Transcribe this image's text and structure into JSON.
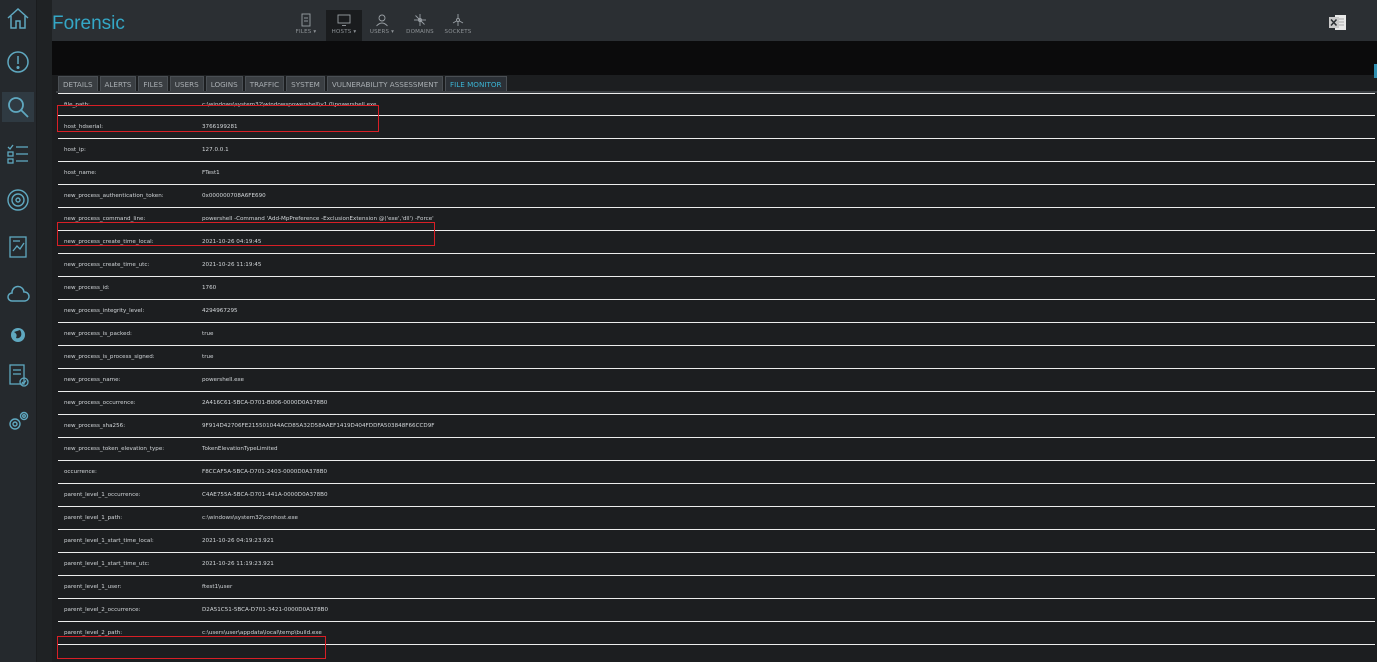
{
  "app": {
    "title": "Forensic"
  },
  "topnav": [
    {
      "label": "FILES ▾",
      "icon": "file-icon"
    },
    {
      "label": "HOSTS ▾",
      "icon": "monitor-icon",
      "active": true
    },
    {
      "label": "USERS ▾",
      "icon": "user-icon"
    },
    {
      "label": "DOMAINS",
      "icon": "network-icon"
    },
    {
      "label": "SOCKETS",
      "icon": "socket-icon"
    }
  ],
  "tabs": [
    {
      "label": "DETAILS"
    },
    {
      "label": "ALERTS"
    },
    {
      "label": "FILES"
    },
    {
      "label": "USERS"
    },
    {
      "label": "LOGINS"
    },
    {
      "label": "TRAFFIC"
    },
    {
      "label": "SYSTEM"
    },
    {
      "label": "VULNERABILITY ASSESSMENT"
    },
    {
      "label": "FILE MONITOR",
      "active": true
    }
  ],
  "rows": [
    {
      "key": "file_path:",
      "value": "c:\\windows\\system32\\windowspowershell\\v1.0\\powershell.exe",
      "highlight": true
    },
    {
      "key": "host_hdserial:",
      "value": "3766199281"
    },
    {
      "key": "host_ip:",
      "value": "127.0.0.1"
    },
    {
      "key": "host_name:",
      "value": "FTest1"
    },
    {
      "key": "new_process_authentication_token:",
      "value": "0x000000708A6FE690"
    },
    {
      "key": "new_process_command_line:",
      "value": "powershell -Command 'Add-MpPreference -ExclusionExtension @('exe','dll') -Force'",
      "highlight": true
    },
    {
      "key": "new_process_create_time_local:",
      "value": "2021-10-26 04:19:45"
    },
    {
      "key": "new_process_create_time_utc:",
      "value": "2021-10-26 11:19:45"
    },
    {
      "key": "new_process_id:",
      "value": "1760"
    },
    {
      "key": "new_process_integrity_level:",
      "value": "4294967295"
    },
    {
      "key": "new_process_is_packed:",
      "value": "true"
    },
    {
      "key": "new_process_is_process_signed:",
      "value": "true"
    },
    {
      "key": "new_process_name:",
      "value": "powershell.exe"
    },
    {
      "key": "new_process_occurrence:",
      "value": "2A416C61-5BCA-D701-B006-0000D0A378B0"
    },
    {
      "key": "new_process_sha256:",
      "value": "9F914D42706FE215501044ACD85A32D58AAEF1419D404FDDFA503848F66CCD9F"
    },
    {
      "key": "new_process_token_elevation_type:",
      "value": "TokenElevationTypeLimited"
    },
    {
      "key": "occurrence:",
      "value": "F8CCAF5A-5BCA-D701-2403-0000D0A378B0"
    },
    {
      "key": "parent_level_1_occurrence:",
      "value": "C4AE755A-5BCA-D701-441A-0000D0A378B0"
    },
    {
      "key": "parent_level_1_path:",
      "value": "c:\\windows\\system32\\conhost.exe"
    },
    {
      "key": "parent_level_1_start_time_local:",
      "value": "2021-10-26 04:19:23.921"
    },
    {
      "key": "parent_level_1_start_time_utc:",
      "value": "2021-10-26 11:19:23.921"
    },
    {
      "key": "parent_level_1_user:",
      "value": "ftest1\\user"
    },
    {
      "key": "parent_level_2_occurrence:",
      "value": "D2A51C51-5BCA-D701-3421-0000D0A378B0"
    },
    {
      "key": "parent_level_2_path:",
      "value": "c:\\users\\user\\appdata\\local\\temp\\build.exe",
      "highlight": true
    }
  ]
}
